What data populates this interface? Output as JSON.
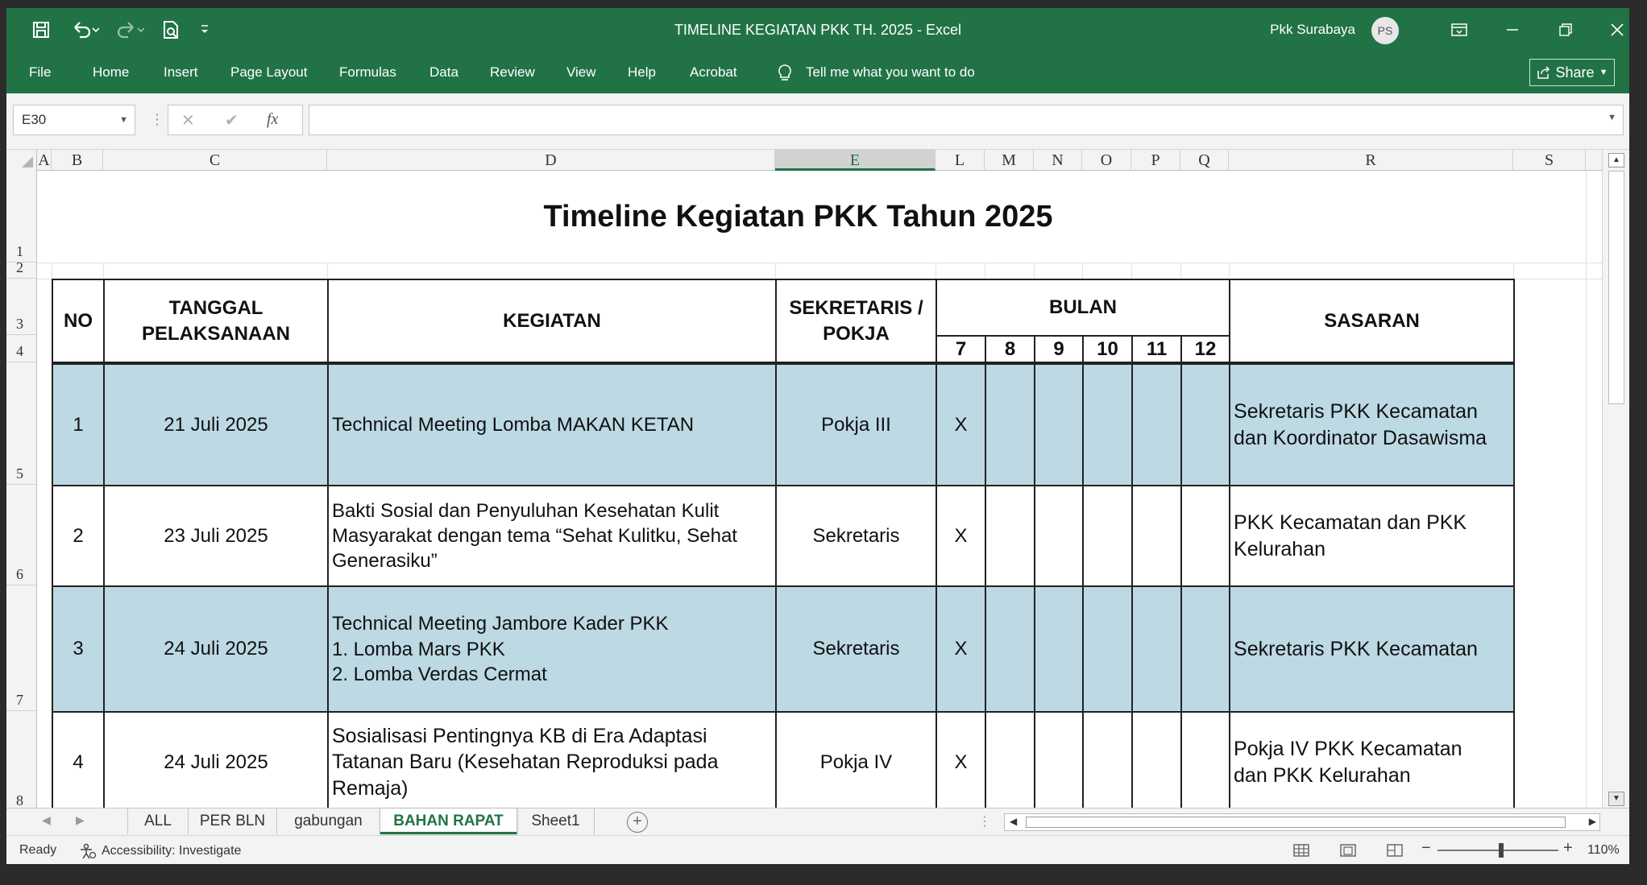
{
  "window": {
    "title": "TIMELINE KEGIATAN PKK TH. 2025  -  Excel",
    "user": "Pkk Surabaya",
    "avatar_initials": "PS"
  },
  "ribbon": {
    "tabs": [
      "File",
      "Home",
      "Insert",
      "Page Layout",
      "Formulas",
      "Data",
      "Review",
      "View",
      "Help",
      "Acrobat"
    ],
    "tell_me": "Tell me what you want to do",
    "share": "Share"
  },
  "formula_bar": {
    "name_box": "E30",
    "formula": ""
  },
  "columns": [
    "A",
    "B",
    "C",
    "D",
    "E",
    "L",
    "M",
    "N",
    "O",
    "P",
    "Q",
    "R",
    "S"
  ],
  "selected_column": "E",
  "rows": [
    "1",
    "2",
    "3",
    "4",
    "5",
    "6",
    "7",
    "8"
  ],
  "sheet": {
    "title": "Timeline Kegiatan PKK Tahun 2025",
    "headers": {
      "no": "NO",
      "tanggal_l1": "TANGGAL",
      "tanggal_l2": "PELAKSANAAN",
      "kegiatan": "KEGIATAN",
      "sekretaris_l1": "SEKRETARIS /",
      "sekretaris_l2": "POKJA",
      "bulan": "BULAN",
      "sasaran": "SASARAN",
      "months": [
        "7",
        "8",
        "9",
        "10",
        "11",
        "12"
      ]
    },
    "entries": [
      {
        "no": "1",
        "tanggal": "21 Juli 2025",
        "kegiatan": [
          "Technical Meeting Lomba MAKAN KETAN"
        ],
        "pokja": "Pokja III",
        "marks": [
          "X",
          "",
          "",
          "",
          "",
          ""
        ],
        "sasaran": [
          "Sekretaris PKK Kecamatan",
          "dan Koordinator Dasawisma"
        ]
      },
      {
        "no": "2",
        "tanggal": "23 Juli 2025",
        "kegiatan": [
          "Bakti Sosial dan Penyuluhan Kesehatan Kulit",
          "Masyarakat dengan tema “Sehat Kulitku, Sehat",
          "Generasiku”"
        ],
        "pokja": "Sekretaris",
        "marks": [
          "X",
          "",
          "",
          "",
          "",
          ""
        ],
        "sasaran": [
          "PKK Kecamatan dan PKK",
          "Kelurahan"
        ]
      },
      {
        "no": "3",
        "tanggal": "24 Juli 2025",
        "kegiatan": [
          "Technical Meeting Jambore Kader PKK",
          "1. Lomba Mars PKK",
          "2. Lomba Verdas Cermat"
        ],
        "pokja": "Sekretaris",
        "marks": [
          "X",
          "",
          "",
          "",
          "",
          ""
        ],
        "sasaran": [
          "Sekretaris PKK Kecamatan"
        ]
      },
      {
        "no": "4",
        "tanggal": "24 Juli 2025",
        "kegiatan": [
          "Sosialisasi Pentingnya KB di Era Adaptasi",
          "Tatanan Baru (Kesehatan Reproduksi pada",
          "Remaja)"
        ],
        "pokja": "Pokja IV",
        "marks": [
          "X",
          "",
          "",
          "",
          "",
          ""
        ],
        "sasaran": [
          "Pokja IV PKK Kecamatan",
          "dan PKK Kelurahan"
        ]
      }
    ]
  },
  "sheet_tabs": [
    "ALL",
    "PER BLN",
    "gabungan",
    "BAHAN RAPAT",
    "Sheet1"
  ],
  "active_sheet": "BAHAN RAPAT",
  "status": {
    "ready": "Ready",
    "accessibility": "Accessibility: Investigate",
    "zoom": "110%"
  },
  "colors": {
    "excel_green": "#217346",
    "row_highlight": "#bcd9e4"
  }
}
